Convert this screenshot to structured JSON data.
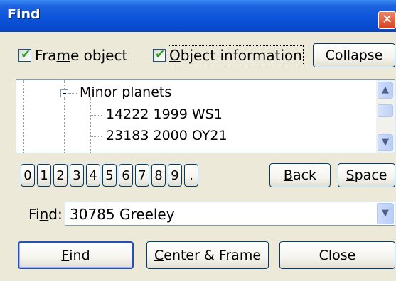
{
  "window": {
    "title": "Find",
    "close_glyph": "✕"
  },
  "options": {
    "frame_object": {
      "label_before": "Fra",
      "label_mnemonic": "m",
      "label_after": "e object",
      "checked": true
    },
    "object_information": {
      "label_before": "",
      "label_mnemonic": "O",
      "label_after": "bject information",
      "checked": true
    },
    "collapse_label": "Collapse"
  },
  "tree": {
    "group_label": "Minor planets",
    "items": [
      "14222 1999 WS1",
      "23183 2000 OY21"
    ],
    "scroll_up_icon": "chevron-up-icon",
    "scroll_down_icon": "chevron-down-icon"
  },
  "keypad": {
    "keys": [
      "0",
      "1",
      "2",
      "3",
      "4",
      "5",
      "6",
      "7",
      "8",
      "9",
      "."
    ],
    "back": {
      "mnemonic": "B",
      "rest": "ack"
    },
    "space": {
      "mnemonic": "S",
      "rest": "pace"
    }
  },
  "find": {
    "label_before": "Fi",
    "label_mnemonic": "n",
    "label_after": "d:",
    "value": "30785 Greeley"
  },
  "actions": {
    "find": {
      "mnemonic": "F",
      "rest": "ind"
    },
    "center_frame": {
      "mnemonic": "C",
      "rest": "enter & Frame"
    },
    "close": "Close"
  }
}
